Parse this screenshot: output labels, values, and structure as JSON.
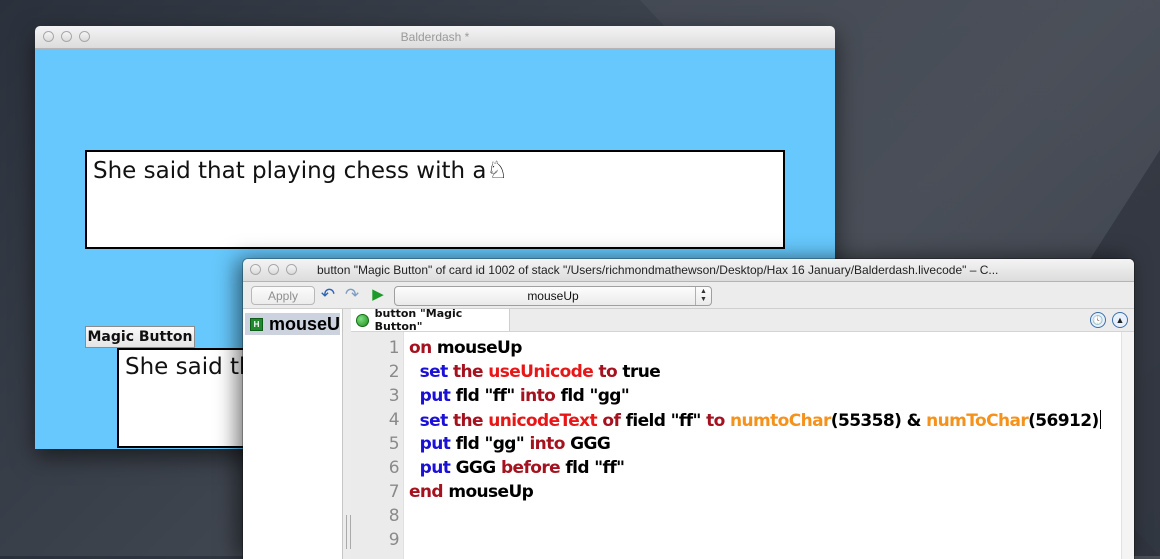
{
  "stack_window": {
    "title": "Balderdash *",
    "field_ff_text": "She said that playing chess with a",
    "field_ff_glyph": "♘",
    "field_gg_text": "She said that playing chess with a",
    "magic_button_label": "Magic Button",
    "card_color": "#66c8fc"
  },
  "script_editor": {
    "title": "button \"Magic Button\" of card id 1002 of stack \"/Users/richmondmathewson/Desktop/Hax 16 January/Balderdash.livecode\" – C...",
    "toolbar": {
      "apply_label": "Apply",
      "undo_icon": "↶",
      "redo_icon": "↷",
      "run_icon": "▶",
      "handler_select_value": "mouseUp"
    },
    "handler_list": [
      {
        "badge": "H",
        "label": "mouseUp"
      }
    ],
    "tab_label": "button \"Magic Button\"",
    "code_lines": [
      {
        "n": "1",
        "tokens": [
          {
            "t": "on ",
            "c": "kw-red"
          },
          {
            "t": "mouseUp",
            "c": "plain"
          }
        ]
      },
      {
        "n": "2",
        "tokens": [
          {
            "t": "  set ",
            "c": "kw-blue"
          },
          {
            "t": "the ",
            "c": "kw-red"
          },
          {
            "t": "useUnicode ",
            "c": "kw-prop"
          },
          {
            "t": "to ",
            "c": "kw-red"
          },
          {
            "t": "true",
            "c": "plain"
          }
        ]
      },
      {
        "n": "3",
        "tokens": [
          {
            "t": "  put ",
            "c": "kw-blue"
          },
          {
            "t": "fld \"ff\" ",
            "c": "plain"
          },
          {
            "t": "into ",
            "c": "kw-red"
          },
          {
            "t": "fld \"gg\"",
            "c": "plain"
          }
        ]
      },
      {
        "n": "4",
        "tokens": [
          {
            "t": "  set ",
            "c": "kw-blue"
          },
          {
            "t": "the ",
            "c": "kw-red"
          },
          {
            "t": "unicodeText ",
            "c": "kw-prop"
          },
          {
            "t": "of ",
            "c": "kw-red"
          },
          {
            "t": "field \"ff\" ",
            "c": "plain"
          },
          {
            "t": "to ",
            "c": "kw-red"
          },
          {
            "t": "numtoChar",
            "c": "kw-fn"
          },
          {
            "t": "(55358) & ",
            "c": "plain"
          },
          {
            "t": "numToChar",
            "c": "kw-fn"
          },
          {
            "t": "(56912)",
            "c": "plain"
          }
        ]
      },
      {
        "n": "5",
        "tokens": [
          {
            "t": "  put ",
            "c": "kw-blue"
          },
          {
            "t": "fld \"gg\" ",
            "c": "plain"
          },
          {
            "t": "into ",
            "c": "kw-red"
          },
          {
            "t": "GGG",
            "c": "plain"
          }
        ]
      },
      {
        "n": "6",
        "tokens": [
          {
            "t": "  put ",
            "c": "kw-blue"
          },
          {
            "t": "GGG ",
            "c": "plain"
          },
          {
            "t": "before ",
            "c": "kw-red"
          },
          {
            "t": "fld \"ff\"",
            "c": "plain"
          }
        ]
      },
      {
        "n": "7",
        "tokens": [
          {
            "t": "end ",
            "c": "kw-red"
          },
          {
            "t": "mouseUp",
            "c": "plain"
          }
        ]
      },
      {
        "n": "8",
        "tokens": []
      },
      {
        "n": "9",
        "tokens": []
      }
    ],
    "caret_line": "4",
    "colors": {
      "keyword_red": "#a3121e",
      "command_blue": "#1a10d6",
      "property_red": "#e81717",
      "function_orange": "#f5921c"
    }
  }
}
